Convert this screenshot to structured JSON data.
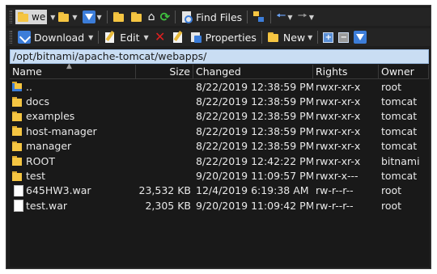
{
  "toolbar1": {
    "drive_label": "we",
    "find_files_label": "Find Files"
  },
  "toolbar2": {
    "download_label": "Download",
    "edit_label": "Edit",
    "properties_label": "Properties",
    "new_label": "New"
  },
  "path": "/opt/bitnami/apache-tomcat/webapps/",
  "columns": {
    "name": "Name",
    "size": "Size",
    "changed": "Changed",
    "rights": "Rights",
    "owner": "Owner"
  },
  "files": [
    {
      "name": "..",
      "size": "",
      "changed": "8/22/2019 12:38:59 PM",
      "rights": "rwxr-xr-x",
      "owner": "root",
      "icon": "parent-folder-icon"
    },
    {
      "name": "docs",
      "size": "",
      "changed": "8/22/2019 12:38:59 PM",
      "rights": "rwxr-xr-x",
      "owner": "tomcat",
      "icon": "folder-icon"
    },
    {
      "name": "examples",
      "size": "",
      "changed": "8/22/2019 12:38:59 PM",
      "rights": "rwxr-xr-x",
      "owner": "tomcat",
      "icon": "folder-icon"
    },
    {
      "name": "host-manager",
      "size": "",
      "changed": "8/22/2019 12:38:59 PM",
      "rights": "rwxr-xr-x",
      "owner": "tomcat",
      "icon": "folder-icon"
    },
    {
      "name": "manager",
      "size": "",
      "changed": "8/22/2019 12:38:59 PM",
      "rights": "rwxr-xr-x",
      "owner": "tomcat",
      "icon": "folder-icon"
    },
    {
      "name": "ROOT",
      "size": "",
      "changed": "8/22/2019 12:42:22 PM",
      "rights": "rwxr-xr-x",
      "owner": "bitnami",
      "icon": "folder-icon"
    },
    {
      "name": "test",
      "size": "",
      "changed": "9/20/2019 11:09:57 PM",
      "rights": "rwxr-x---",
      "owner": "tomcat",
      "icon": "folder-icon"
    },
    {
      "name": "645HW3.war",
      "size": "23,532 KB",
      "changed": "12/4/2019 6:19:38 AM",
      "rights": "rw-r--r--",
      "owner": "root",
      "icon": "file-icon"
    },
    {
      "name": "test.war",
      "size": "2,305 KB",
      "changed": "9/20/2019 11:09:42 PM",
      "rights": "rw-r--r--",
      "owner": "root",
      "icon": "file-icon"
    }
  ],
  "colors": {
    "background": "#1e1e1e",
    "path_bar": "#c9ddf3",
    "folder": "#f5c542"
  }
}
